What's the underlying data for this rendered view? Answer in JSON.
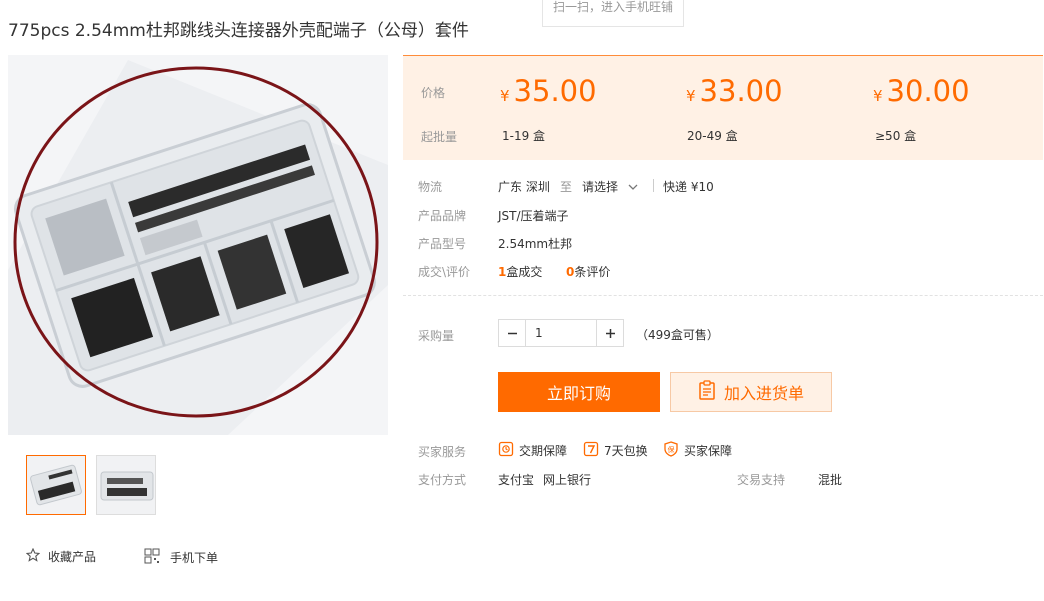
{
  "product": {
    "title": "775pcs 2.54mm杜邦跳线头连接器外壳配端子（公母）套件",
    "qr_hint": "扫一扫，进入手机旺铺"
  },
  "gallery": {
    "thumb_count": 2,
    "favorite_label": "收藏产品",
    "mobile_order_label": "手机下单"
  },
  "pricing": {
    "price_label": "价格",
    "moq_label": "起批量",
    "currency_symbol": "¥",
    "tiers": [
      {
        "price": "35.00",
        "range": "1-19 盒"
      },
      {
        "price": "33.00",
        "range": "20-49 盒"
      },
      {
        "price": "30.00",
        "range": "≥50 盒"
      }
    ]
  },
  "shipping": {
    "label": "物流",
    "from": "广东 深圳",
    "to_word": "至",
    "destination": "请选择",
    "method": "快递 ¥10"
  },
  "details": {
    "brand_label": "产品品牌",
    "brand": "JST/压着端子",
    "model_label": "产品型号",
    "model": "2.54mm杜邦",
    "deals_label": "成交\\评价",
    "deals_count": "1",
    "deals_unit": "盒成交",
    "reviews_count": "0",
    "reviews_unit": "条评价"
  },
  "purchase": {
    "qty_label": "采购量",
    "quantity": "1",
    "stock_text": "（499盒可售）",
    "buy_now": "立即订购",
    "add_to_cart": "加入进货单"
  },
  "services": {
    "label": "买家服务",
    "items": [
      "交期保障",
      "7天包换",
      "买家保障"
    ],
    "payment_label": "支付方式",
    "payment_methods": [
      "支付宝",
      "网上银行"
    ],
    "trade_support_label": "交易支持",
    "trade_support_value": "混批"
  },
  "colors": {
    "accent": "#ff6a00",
    "price_bg": "#fff1e5",
    "label_gray": "#999999"
  }
}
